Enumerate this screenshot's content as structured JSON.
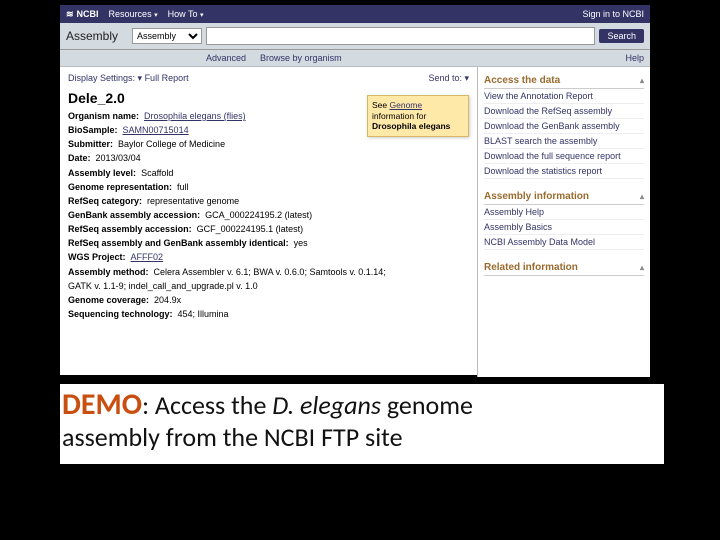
{
  "topnav": {
    "brand": "NCBI",
    "resources": "Resources",
    "howto": "How To",
    "signin": "Sign in to NCBI"
  },
  "searchbar": {
    "title": "Assembly",
    "selected": "Assembly",
    "placeholder": "",
    "button": "Search"
  },
  "sublinks": {
    "advanced": "Advanced",
    "browse": "Browse by organism",
    "help": "Help"
  },
  "main": {
    "display_settings": "Display Settings:",
    "full_report": "Full Report",
    "send_to": "Send to:",
    "title": "Dele_2.0",
    "fields": {
      "organism_label": "Organism name:",
      "organism_val": "Drosophila elegans (flies)",
      "biosample_label": "BioSample:",
      "biosample_val": "SAMN00715014",
      "submitter_label": "Submitter:",
      "submitter_val": "Baylor College of Medicine",
      "date_label": "Date:",
      "date_val": "2013/03/04",
      "level_label": "Assembly level:",
      "level_val": "Scaffold",
      "repr_label": "Genome representation:",
      "repr_val": "full",
      "refseq_cat_label": "RefSeq category:",
      "refseq_cat_val": "representative genome",
      "gb_acc_label": "GenBank assembly accession:",
      "gb_acc_val": "GCA_000224195.2 (latest)",
      "rs_acc_label": "RefSeq assembly accession:",
      "rs_acc_val": "GCF_000224195.1 (latest)",
      "identical_label": "RefSeq assembly and GenBank assembly identical:",
      "identical_val": "yes",
      "wgs_label": "WGS Project:",
      "wgs_val": "AFFF02",
      "method_label": "Assembly method:",
      "method_val": "Celera Assembler v. 6.1; BWA v. 0.6.0; Samtools v. 0.1.14;",
      "method_val2": "GATK v. 1.1-9; indel_call_and_upgrade.pl v. 1.0",
      "cov_label": "Genome coverage:",
      "cov_val": "204.9x",
      "seq_label": "Sequencing technology:",
      "seq_val": "454; Illumina"
    },
    "note": {
      "pre": "See ",
      "link": "Genome",
      "mid": "information for",
      "bold": "Drosophila elegans"
    }
  },
  "side": {
    "access": {
      "h": "Access the data",
      "links": [
        "View the Annotation Report",
        "Download the RefSeq assembly",
        "Download the GenBank assembly",
        "BLAST search the assembly",
        "Download the full sequence report",
        "Download the statistics report"
      ]
    },
    "info": {
      "h": "Assembly information",
      "links": [
        "Assembly Help",
        "Assembly Basics",
        "NCBI Assembly Data Model"
      ]
    },
    "related": {
      "h": "Related information"
    }
  },
  "caption": {
    "demo": "DEMO",
    "colon": ": ",
    "t1": "Access the ",
    "ital": "D. elegans",
    "t2": " genome",
    "t3": "assembly from the NCBI FTP site"
  }
}
